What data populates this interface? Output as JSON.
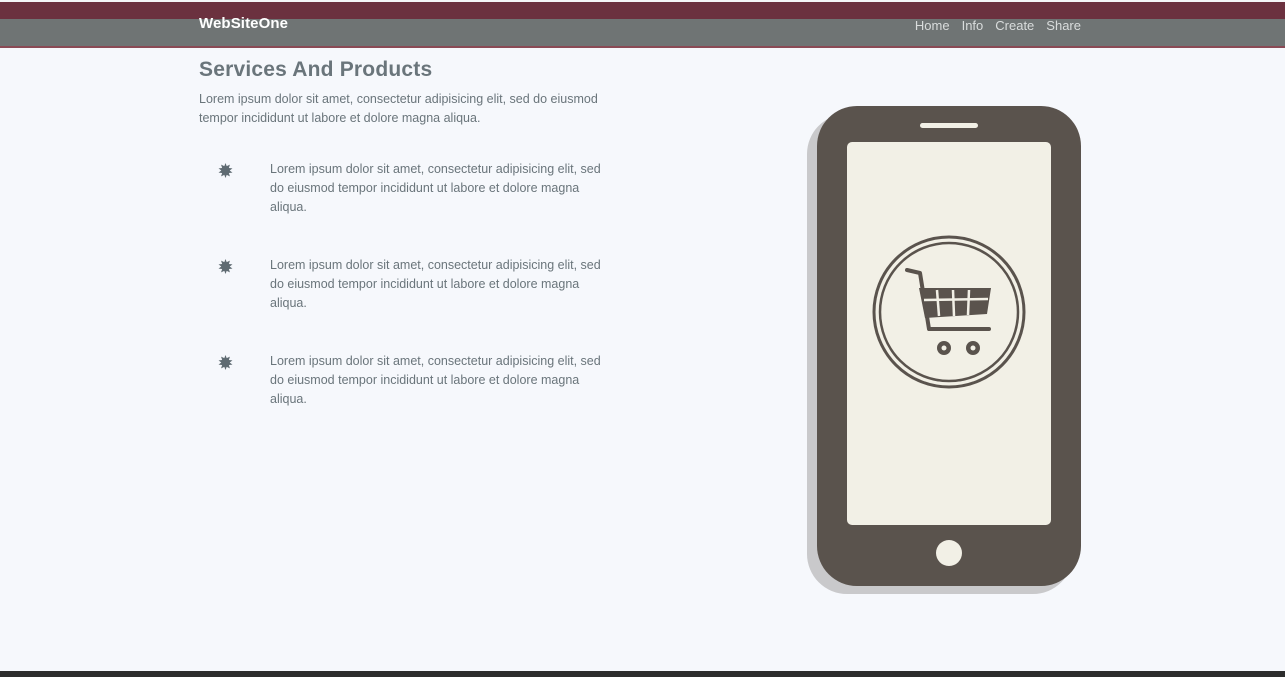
{
  "navbar": {
    "brand": "WebSiteOne",
    "links": [
      {
        "label": "Home"
      },
      {
        "label": "Info"
      },
      {
        "label": "Create"
      },
      {
        "label": "Share"
      }
    ]
  },
  "main": {
    "title": "Services And Products",
    "intro": "Lorem ipsum dolor sit amet, consectetur adipisicing elit, sed do eiusmod tempor incididunt ut labore et dolore magna aliqua."
  },
  "features": [
    {
      "icon": "burst-bullet-icon",
      "text": "Lorem ipsum dolor sit amet, consectetur adipisicing elit, sed do eiusmod tempor incididunt ut labore et dolore magna aliqua."
    },
    {
      "icon": "burst-bullet-icon",
      "text": "Lorem ipsum dolor sit amet, consectetur adipisicing elit, sed do eiusmod tempor incididunt ut labore et dolore magna aliqua."
    },
    {
      "icon": "burst-bullet-icon",
      "text": "Lorem ipsum dolor sit amet, consectetur adipisicing elit, sed do eiusmod tempor incididunt ut labore et dolore magna aliqua."
    }
  ],
  "illustration": {
    "icon": "shopping-cart-icon",
    "colors": {
      "phone_body": "#5a534d",
      "phone_shadow": "#c9c9cb",
      "screen": "#f2f0e6",
      "accent": "#6b313f"
    }
  }
}
